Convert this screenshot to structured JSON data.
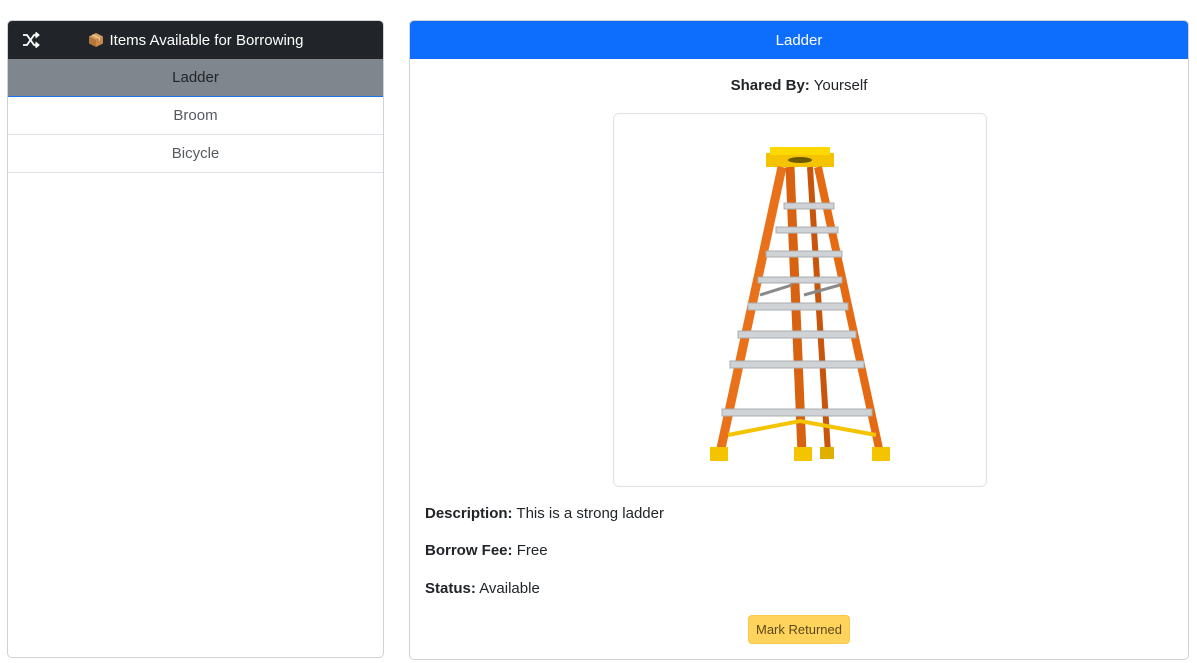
{
  "sidebar": {
    "title": "Items Available for Borrowing",
    "items": [
      {
        "label": "Ladder"
      },
      {
        "label": "Broom"
      },
      {
        "label": "Bicycle"
      }
    ]
  },
  "detail": {
    "title": "Ladder",
    "shared_by_label": "Shared By:",
    "shared_by_value": "Yourself",
    "description_label": "Description:",
    "description_value": "This is a strong ladder",
    "fee_label": "Borrow Fee:",
    "fee_value": "Free",
    "status_label": "Status:",
    "status_value": "Available",
    "action_label": "Mark Returned",
    "image_icon": "ladder-image"
  },
  "colors": {
    "sidebar_header": "#212529",
    "active_item": "#7f868d",
    "detail_header": "#0d6efd",
    "action_button": "#ffd35c"
  }
}
